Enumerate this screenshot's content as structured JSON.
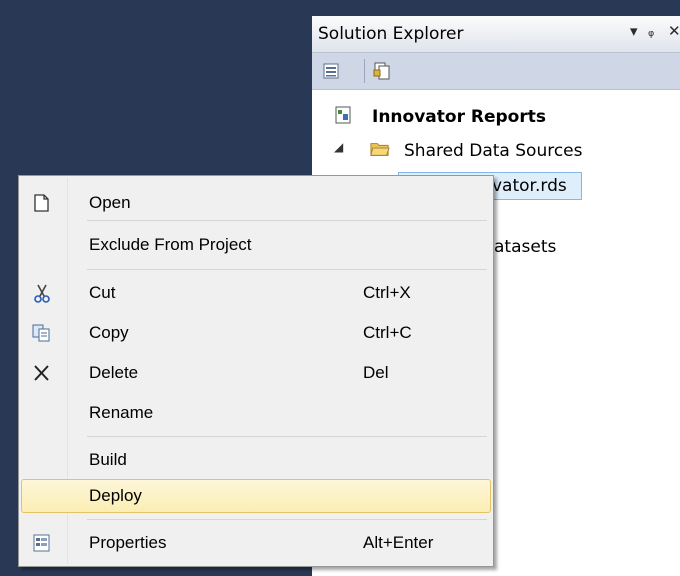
{
  "solution_explorer": {
    "title": "Solution Explorer",
    "title_buttons": {
      "dropdown": "▾",
      "pin": "ᵩ",
      "close": "✕"
    },
    "toolbar": {
      "icons": [
        "properties-icon",
        "show-all-files-icon"
      ]
    },
    "tree": {
      "project": "Innovator Reports",
      "shared_data_sources": "Shared Data Sources",
      "selected_file": "vator.rds",
      "datasets": "atasets"
    }
  },
  "context_menu": {
    "items": [
      {
        "label": "Open",
        "shortcut": "",
        "icon": "open-icon"
      },
      {
        "label": "Exclude From Project",
        "shortcut": "",
        "icon": ""
      },
      {
        "label": "Cut",
        "shortcut": "Ctrl+X",
        "icon": "cut-icon"
      },
      {
        "label": "Copy",
        "shortcut": "Ctrl+C",
        "icon": "copy-icon"
      },
      {
        "label": "Delete",
        "shortcut": "Del",
        "icon": "delete-icon"
      },
      {
        "label": "Rename",
        "shortcut": "",
        "icon": ""
      },
      {
        "label": "Build",
        "shortcut": "",
        "icon": ""
      },
      {
        "label": "Deploy",
        "shortcut": "",
        "icon": "",
        "highlighted": true
      },
      {
        "label": "Properties",
        "shortcut": "Alt+Enter",
        "icon": "properties-icon"
      }
    ]
  },
  "colors": {
    "background": "#293955",
    "highlight_border": "#e5c365",
    "selection_fill": "#dfeefb"
  }
}
